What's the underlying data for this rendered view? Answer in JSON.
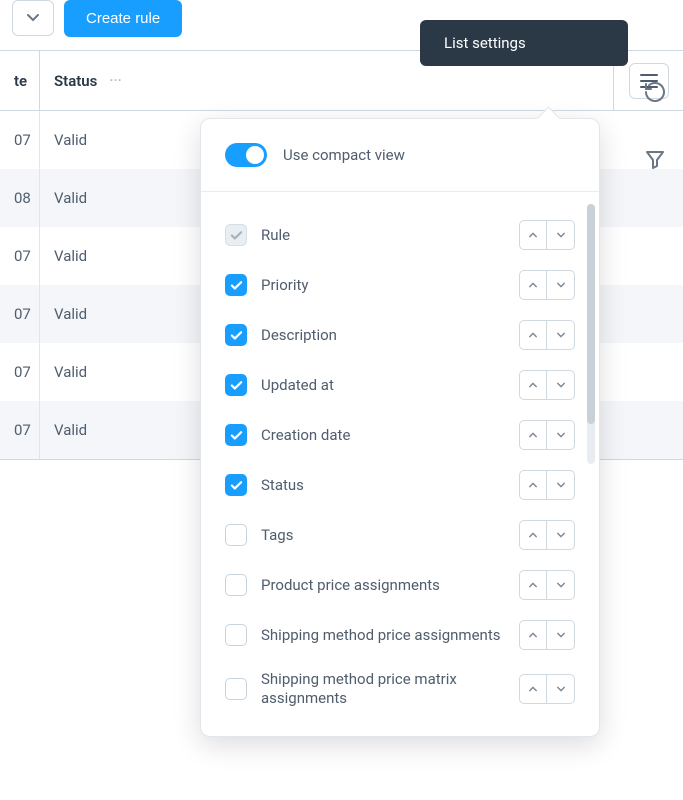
{
  "toolbar": {
    "create_rule_label": "Create rule"
  },
  "list_settings_tooltip": "List settings",
  "table": {
    "columns": {
      "date": "te",
      "status": "Status"
    },
    "rows": [
      {
        "date": "07",
        "status": "Valid",
        "alt": false
      },
      {
        "date": "08",
        "status": "Valid",
        "alt": true
      },
      {
        "date": "07",
        "status": "Valid",
        "alt": false
      },
      {
        "date": "07",
        "status": "Valid",
        "alt": true
      },
      {
        "date": "07",
        "status": "Valid",
        "alt": false
      },
      {
        "date": "07",
        "status": "Valid",
        "alt": true
      }
    ]
  },
  "popover": {
    "compact_label": "Use compact view",
    "columns": [
      {
        "label": "Rule",
        "state": "locked"
      },
      {
        "label": "Priority",
        "state": "checked"
      },
      {
        "label": "Description",
        "state": "checked"
      },
      {
        "label": "Updated at",
        "state": "checked"
      },
      {
        "label": "Creation date",
        "state": "checked"
      },
      {
        "label": "Status",
        "state": "checked"
      },
      {
        "label": "Tags",
        "state": "unchecked"
      },
      {
        "label": "Product price assignments",
        "state": "unchecked"
      },
      {
        "label": "Shipping method price assignments",
        "state": "unchecked"
      },
      {
        "label": "Shipping method price matrix assignments",
        "state": "unchecked"
      }
    ]
  }
}
